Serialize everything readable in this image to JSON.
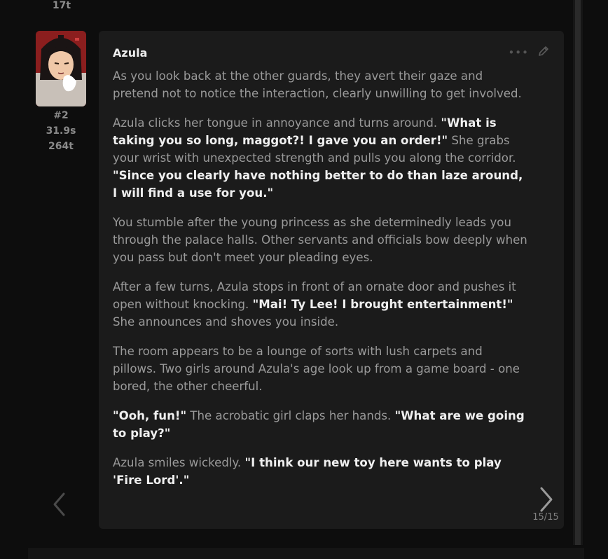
{
  "previous_message": {
    "tokens": "17t"
  },
  "message": {
    "avatar_alt": "Azula avatar",
    "index": "#2",
    "time": "31.9s",
    "tokens": "264t",
    "character_name": "Azula",
    "paragraphs": [
      [
        {
          "t": "As you look back at the other guards, they avert their gaze and pretend not to notice the interaction, clearly unwilling to get involved.",
          "bold": false
        }
      ],
      [
        {
          "t": "Azula clicks her tongue in annoyance and turns around. ",
          "bold": false
        },
        {
          "t": "\"What is taking you so long, maggot?! I gave you an order!\"",
          "bold": true
        },
        {
          "t": " She grabs your wrist with unexpected strength and pulls you along the corridor. ",
          "bold": false
        },
        {
          "t": "\"Since you clearly have nothing better to do than laze around, I will find a use for you.\"",
          "bold": true
        }
      ],
      [
        {
          "t": "You stumble after the young princess as she determinedly leads you through the palace halls. Other servants and officials bow deeply when you pass but don't meet your pleading eyes.",
          "bold": false
        }
      ],
      [
        {
          "t": "After a few turns, Azula stops in front of an ornate door and pushes it open without knocking. ",
          "bold": false
        },
        {
          "t": "\"Mai! Ty Lee! I brought entertainment!\"",
          "bold": true
        },
        {
          "t": " She announces and shoves you inside.",
          "bold": false
        }
      ],
      [
        {
          "t": "The room appears to be a lounge of sorts with lush carpets and pillows. Two girls around Azula's age look up from a game board - one bored, the other cheerful.",
          "bold": false
        }
      ],
      [
        {
          "t": "\"Ooh, fun!\"",
          "bold": true
        },
        {
          "t": " The acrobatic girl claps her hands. ",
          "bold": false
        },
        {
          "t": "\"What are we going to play?\"",
          "bold": true
        }
      ],
      [
        {
          "t": "Azula smiles wickedly. ",
          "bold": false
        },
        {
          "t": "\"I think our new toy here wants to play 'Fire Lord'.\"",
          "bold": true
        }
      ]
    ]
  },
  "swipe": {
    "current": "15",
    "total": "15",
    "label": "15/15"
  },
  "icons": {
    "more": "more-dots-icon",
    "edit": "pencil-icon",
    "prev": "chevron-left-icon",
    "next": "chevron-right-icon"
  },
  "colors": {
    "background": "#0d0d0d",
    "card": "#1b1b1b",
    "text_dim": "#9a9a9a",
    "text_bold": "#efefef"
  }
}
